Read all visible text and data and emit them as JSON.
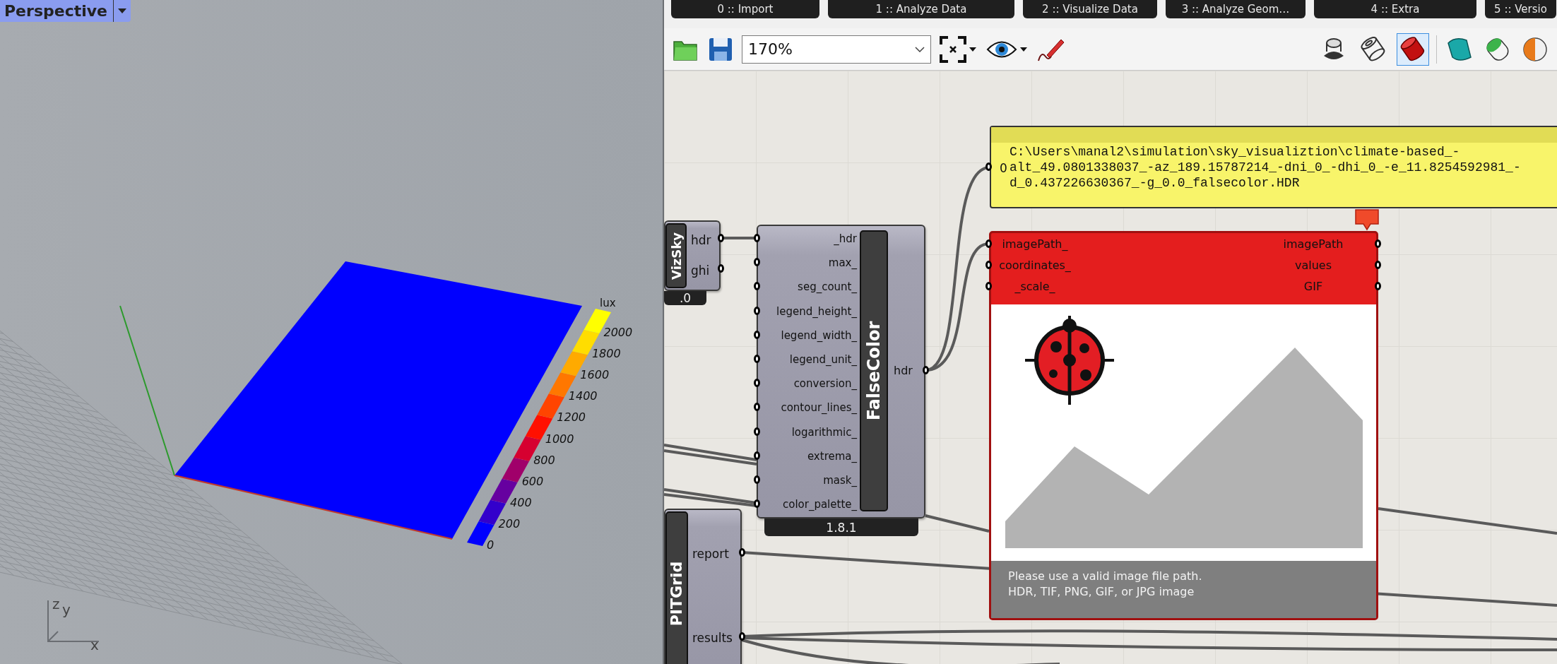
{
  "viewport": {
    "title": "Perspective",
    "axes": [
      "z",
      "y",
      "x"
    ],
    "legend": {
      "unit": "lux",
      "items": [
        {
          "label": "0",
          "color": "#0000ff"
        },
        {
          "label": "200",
          "color": "#3300cc"
        },
        {
          "label": "400",
          "color": "#6600a0"
        },
        {
          "label": "600",
          "color": "#a0006a"
        },
        {
          "label": "800",
          "color": "#d60030"
        },
        {
          "label": "1000",
          "color": "#ff1000"
        },
        {
          "label": "1200",
          "color": "#ff4400"
        },
        {
          "label": "1400",
          "color": "#ff7700"
        },
        {
          "label": "1600",
          "color": "#ffaa00"
        },
        {
          "label": "1800",
          "color": "#ffdd00"
        },
        {
          "label": "2000",
          "color": "#ffff00"
        }
      ]
    }
  },
  "component_tabs": [
    {
      "label": "0 :: Import"
    },
    {
      "label": "1 :: Analyze Data"
    },
    {
      "label": "2 :: Visualize Data"
    },
    {
      "label": "3 :: Analyze Geom…"
    },
    {
      "label": "4 :: Extra"
    },
    {
      "label": "5 :: Versio"
    }
  ],
  "toolbar": {
    "zoom": "170%",
    "preview_modes": [
      {
        "selected": false
      },
      {
        "selected": false
      },
      {
        "selected": true
      }
    ]
  },
  "canvas": {
    "panel": {
      "input": "0",
      "text": "C:\\Users\\manal2\\simulation\\sky_visualiztion\\climate-based_-alt_49.0801338037_-az_189.15787214_-dni_0_-dhi_0_-e_11.8254592981_-d_0.437226630367_-g_0.0_falsecolor.HDR"
    },
    "vizsky": {
      "title": "VizSky",
      "outputs": [
        "hdr",
        "ghi"
      ],
      "version": ".0"
    },
    "falsecolor": {
      "title": "FalseColor",
      "inputs": [
        "_hdr",
        "max_",
        "seg_count_",
        "legend_height_",
        "legend_width_",
        "legend_unit_",
        "conversion_",
        "contour_lines_",
        "logarithmic_",
        "extrema_",
        "mask_",
        "color_palette_"
      ],
      "outputs": [
        "hdr"
      ],
      "version": "1.8.1"
    },
    "image_viewer": {
      "inputs": [
        "imagePath_",
        "coordinates_",
        "_scale_"
      ],
      "outputs": [
        "imagePath",
        "values",
        "GIF"
      ],
      "message": [
        "Please use a valid image file path.",
        "HDR, TIF, PNG, GIF, or JPG image"
      ]
    },
    "pitgrid": {
      "title": "PITGrid",
      "outputs": [
        "report",
        "results"
      ]
    }
  }
}
